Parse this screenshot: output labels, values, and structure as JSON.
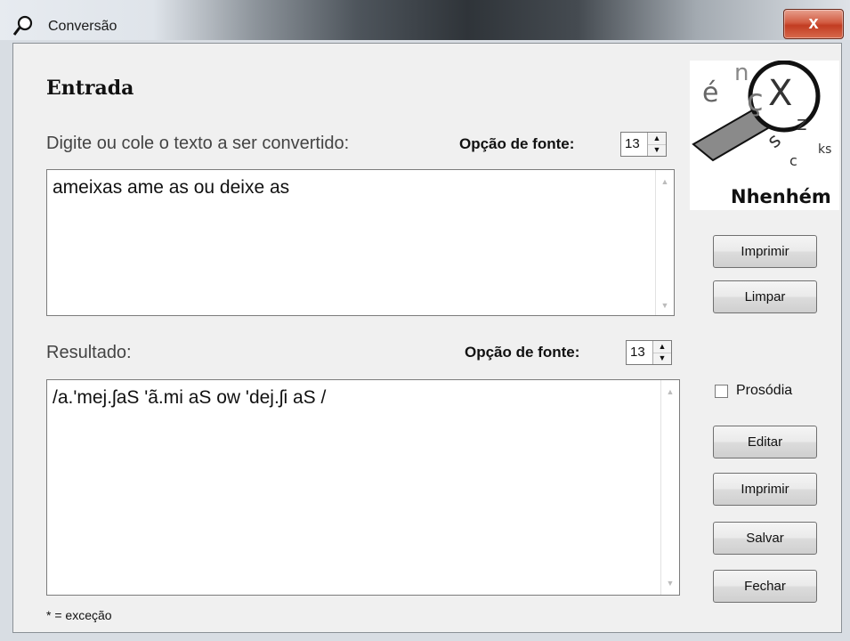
{
  "window": {
    "title": "Conversão",
    "close_label": "x"
  },
  "input_section": {
    "heading": "Entrada",
    "prompt": "Digite ou cole o texto a ser convertido:",
    "font_option_label": "Opção de fonte:",
    "font_size": "13",
    "text": "ameixas ame as ou deixe as"
  },
  "result_section": {
    "label": "Resultado:",
    "font_option_label": "Opção de fonte:",
    "font_size": "13",
    "text": "/a.'mej.ʃaS 'ã.mi aS ow 'dej.ʃi aS /"
  },
  "logo": {
    "name": "Nhenhém",
    "letters": [
      "é",
      "n",
      "ç",
      "X",
      "s",
      "z",
      "ks",
      "c"
    ]
  },
  "buttons": {
    "print_top": "Imprimir",
    "clear": "Limpar",
    "edit": "Editar",
    "print_bottom": "Imprimir",
    "save": "Salvar",
    "close": "Fechar"
  },
  "prosody": {
    "label": "Prosódia",
    "checked": false
  },
  "footer_note": "* = exceção"
}
